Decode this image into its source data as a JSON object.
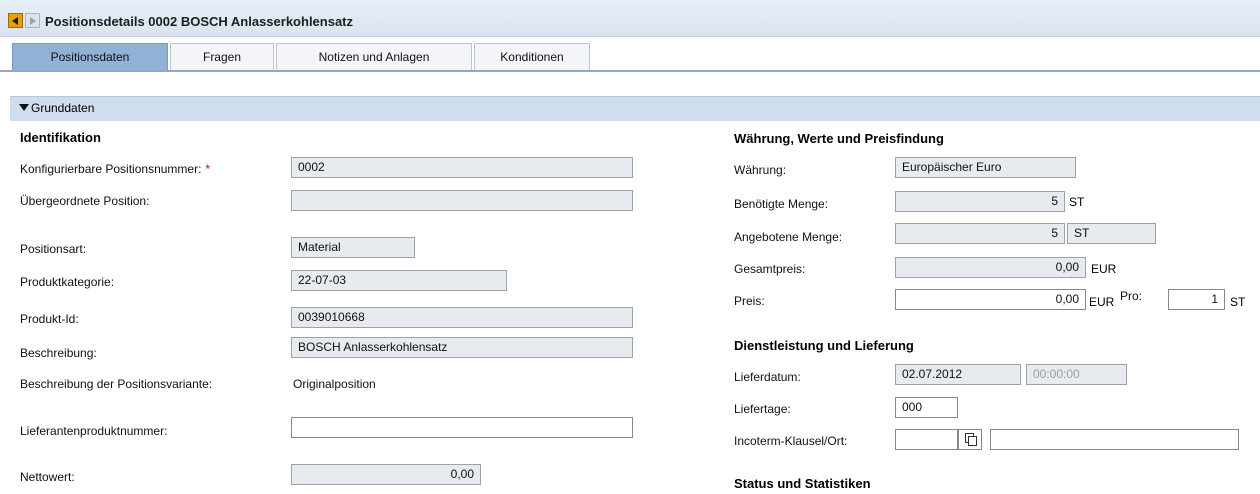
{
  "title": "Positionsdetails 0002 BOSCH Anlasserkohlensatz",
  "tabs": [
    "Positionsdaten",
    "Fragen",
    "Notizen und Anlagen",
    "Konditionen"
  ],
  "section": {
    "label": "Grunddaten"
  },
  "left": {
    "heading": "Identifikation",
    "konfig_label": "Konfigurierbare Positionsnummer:",
    "required_mark": "*",
    "konfig_value": "0002",
    "uebergeordnet_label": "Übergeordnete Position:",
    "uebergeordnet_value": "",
    "positionsart_label": "Positionsart:",
    "positionsart_value": "Material",
    "produktkategorie_label": "Produktkategorie:",
    "produktkategorie_value": "22-07-03",
    "produkt_id_label": "Produkt-Id:",
    "produkt_id_value": "0039010668",
    "beschreibung_label": "Beschreibung:",
    "beschreibung_value": "BOSCH Anlasserkohlensatz",
    "variante_label": "Beschreibung der Positionsvariante:",
    "variante_value": "Originalposition",
    "lieferantenprodukt_label": "Lieferantenproduktnummer:",
    "lieferantenprodukt_value": "",
    "nettowert_label": "Nettowert:",
    "nettowert_value": "0,00"
  },
  "right": {
    "waehrung_heading": "Währung, Werte und Preisfindung",
    "waehrung_label": "Währung:",
    "waehrung_value": "Europäischer Euro",
    "benoetigte_label": "Benötigte Menge:",
    "benoetigte_value": "5",
    "benoetigte_unit": "ST",
    "angebotene_label": "Angebotene Menge:",
    "angebotene_value": "5",
    "angebotene_unit": "ST",
    "gesamtpreis_label": "Gesamtpreis:",
    "gesamtpreis_value": "0,00",
    "gesamtpreis_unit": "EUR",
    "preis_label": "Preis:",
    "preis_value": "0,00",
    "preis_unit": "EUR",
    "pro_label": "Pro:",
    "pro_value": "1",
    "pro_unit": "ST",
    "dienst_heading": "Dienstleistung und Lieferung",
    "lieferdatum_label": "Lieferdatum:",
    "lieferdatum_value": "02.07.2012",
    "lieferzeit_value": "00:00:00",
    "liefertage_label": "Liefertage:",
    "liefertage_value": "000",
    "incoterm_label": "Incoterm-Klausel/Ort:",
    "incoterm_value": "",
    "incoterm_ort_value": "",
    "status_heading": "Status und Statistiken"
  }
}
